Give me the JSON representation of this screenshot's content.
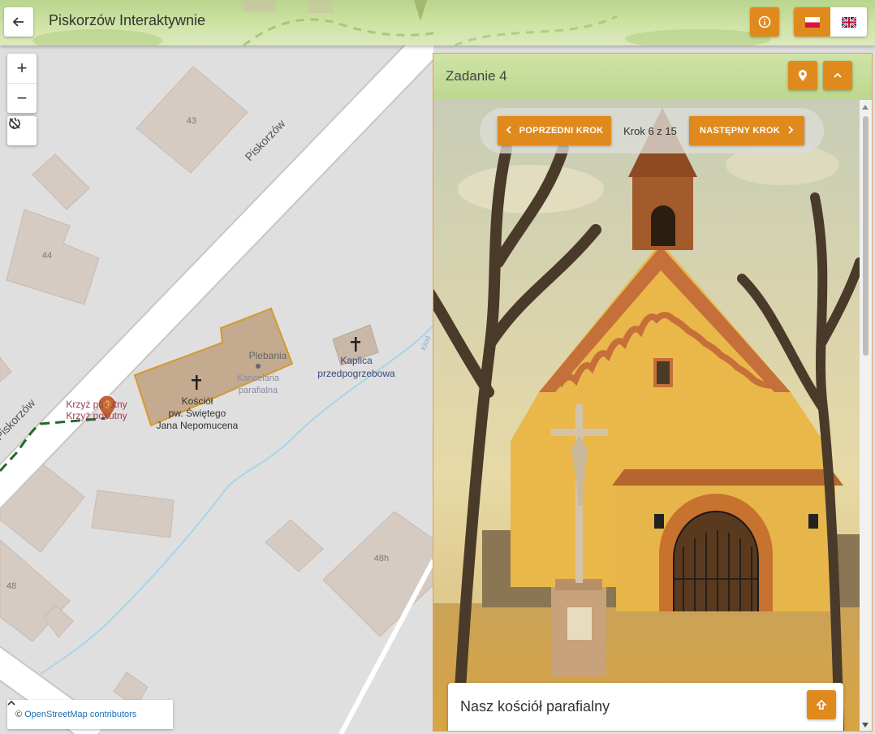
{
  "header": {
    "back_icon": "arrow-left-icon",
    "title": "Piskorzów Interaktywnie",
    "info_icon": "info-circle-icon",
    "languages": [
      {
        "code": "pl",
        "flag": "flag-poland-icon",
        "active": true
      },
      {
        "code": "en",
        "flag": "flag-uk-icon",
        "active": false
      }
    ],
    "accent_color": "#e08a1e"
  },
  "map": {
    "zoom_in_label": "+",
    "zoom_out_label": "−",
    "rotate_icon": "compass-reset-icon",
    "labels": {
      "street_main": "Piskorzów",
      "street_side": "Piskorzów",
      "house_43": "43",
      "house_44": "44",
      "house_48": "48",
      "house_48h": "48h",
      "cross_1": "Krzyż pokutny",
      "cross_2": "Krzyż pokutny",
      "church_1": "Kościół",
      "church_2": "pw. Świętego",
      "church_3": "Jana Nepomucena",
      "rectory": "Plebania",
      "office_1": "Kancelaria",
      "office_2": "parafialna",
      "chapel_1": "Kaplica",
      "chapel_2": "przedpogrzebowa",
      "stream": "Kłod"
    },
    "attribution": {
      "copyright": "©",
      "link": "OpenStreetMap contributors",
      "toggle_icon": "chevron-up-icon"
    }
  },
  "panel": {
    "title": "Zadanie 4",
    "location_icon": "map-pin-icon",
    "collapse_icon": "chevron-up-icon",
    "prev_label": "POPRZEDNI KROK",
    "next_label": "NASTĘPNY KROK",
    "step_text": "Krok 6 z 15",
    "card_title": "Nasz kościół parafialny",
    "card_icon": "arrow-up-box-icon"
  }
}
